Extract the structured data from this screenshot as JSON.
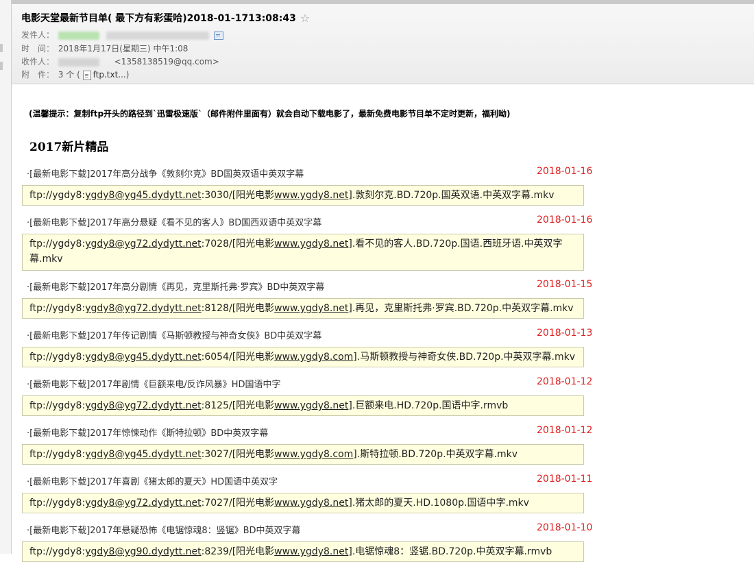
{
  "email": {
    "subject": "电影天堂最新节目单( 最下方有彩蛋哈)2018-01-1713:08:43",
    "star_glyph": "☆",
    "sender_label": "发件人：",
    "time_label": "时　间：",
    "time_value": "2018年1月17日(星期三) 中午1:08",
    "recipient_label": "收件人：",
    "recipient_email": "<1358138519@qq.com>",
    "attach_label": "附　件：",
    "attach_count": "3 个 (",
    "attach_file": "ftp.txt...",
    "attach_close": ")"
  },
  "body": {
    "tip": "(温馨提示：复制ftp开头的路径到`迅雷极速版`（邮件附件里面有）就会自动下载电影了，最新免费电影节目单不定时更新，福利呦)",
    "section_title": "2017新片精品",
    "entries": [
      {
        "title": "·[最新电影下载]2017年高分战争《敦刻尔克》BD国英双语中英双字幕",
        "date": "2018-01-16",
        "ftp_prefix": "ftp://ygdy8:",
        "ftp_user": "ygdy8@yg45.dydytt.net",
        "ftp_port": ":3030/[阳光电影",
        "ftp_site": "www.ygdy8.net",
        "ftp_file": "].敦刻尔克.BD.720p.国英双语.中英双字幕.mkv"
      },
      {
        "title": "·[最新电影下载]2017年高分悬疑《看不见的客人》BD国西双语中英双字幕",
        "date": "2018-01-16",
        "ftp_prefix": "ftp://ygdy8:",
        "ftp_user": "ygdy8@yg72.dydytt.net",
        "ftp_port": ":7028/[阳光电影",
        "ftp_site": "www.ygdy8.net",
        "ftp_file": "].看不见的客人.BD.720p.国语.西班牙语.中英双字幕.mkv"
      },
      {
        "title": "·[最新电影下载]2017年高分剧情《再见，克里斯托弗·罗宾》BD中英双字幕",
        "date": "2018-01-15",
        "ftp_prefix": "ftp://ygdy8:",
        "ftp_user": "ygdy8@yg72.dydytt.net",
        "ftp_port": ":8128/[阳光电影",
        "ftp_site": "www.ygdy8.net",
        "ftp_file": "].再见，克里斯托弗·罗宾.BD.720p.中英双字幕.mkv"
      },
      {
        "title": "·[最新电影下载]2017年传记剧情《马斯顿教授与神奇女侠》BD中英双字幕",
        "date": "2018-01-13",
        "ftp_prefix": "ftp://ygdy8:",
        "ftp_user": "ygdy8@yg45.dydytt.net",
        "ftp_port": ":6054/[阳光电影",
        "ftp_site": "www.ygdy8.com",
        "ftp_file": "].马斯顿教授与神奇女侠.BD.720p.中英双字幕.mkv"
      },
      {
        "title": "·[最新电影下载]2017年剧情《巨额来电/反诈风暴》HD国语中字",
        "date": "2018-01-12",
        "ftp_prefix": "ftp://ygdy8:",
        "ftp_user": "ygdy8@yg72.dydytt.net",
        "ftp_port": ":8125/[阳光电影",
        "ftp_site": "www.ygdy8.net",
        "ftp_file": "].巨额来电.HD.720p.国语中字.rmvb"
      },
      {
        "title": "·[最新电影下载]2017年惊悚动作《斯特拉顿》BD中英双字幕",
        "date": "2018-01-12",
        "ftp_prefix": "ftp://ygdy8:",
        "ftp_user": "ygdy8@yg45.dydytt.net",
        "ftp_port": ":3027/[阳光电影",
        "ftp_site": "www.ygdy8.com",
        "ftp_file": "].斯特拉顿.BD.720p.中英双字幕.mkv"
      },
      {
        "title": "·[最新电影下载]2017年喜剧《猪太郎的夏天》HD国语中英双字",
        "date": "2018-01-11",
        "ftp_prefix": "ftp://ygdy8:",
        "ftp_user": "ygdy8@yg72.dydytt.net",
        "ftp_port": ":7027/[阳光电影",
        "ftp_site": "www.ygdy8.net",
        "ftp_file": "].猪太郎的夏天.HD.1080p.国语中字.mkv"
      },
      {
        "title": "·[最新电影下载]2017年悬疑恐怖《电锯惊魂8：竖锯》BD中英双字幕",
        "date": "2018-01-10",
        "ftp_prefix": "ftp://ygdy8:",
        "ftp_user": "ygdy8@yg90.dydytt.net",
        "ftp_port": ":8239/[阳光电影",
        "ftp_site": "www.ygdy8.net",
        "ftp_file": "].电锯惊魂8：竖锯.BD.720p.中英双字幕.rmvb"
      }
    ]
  }
}
